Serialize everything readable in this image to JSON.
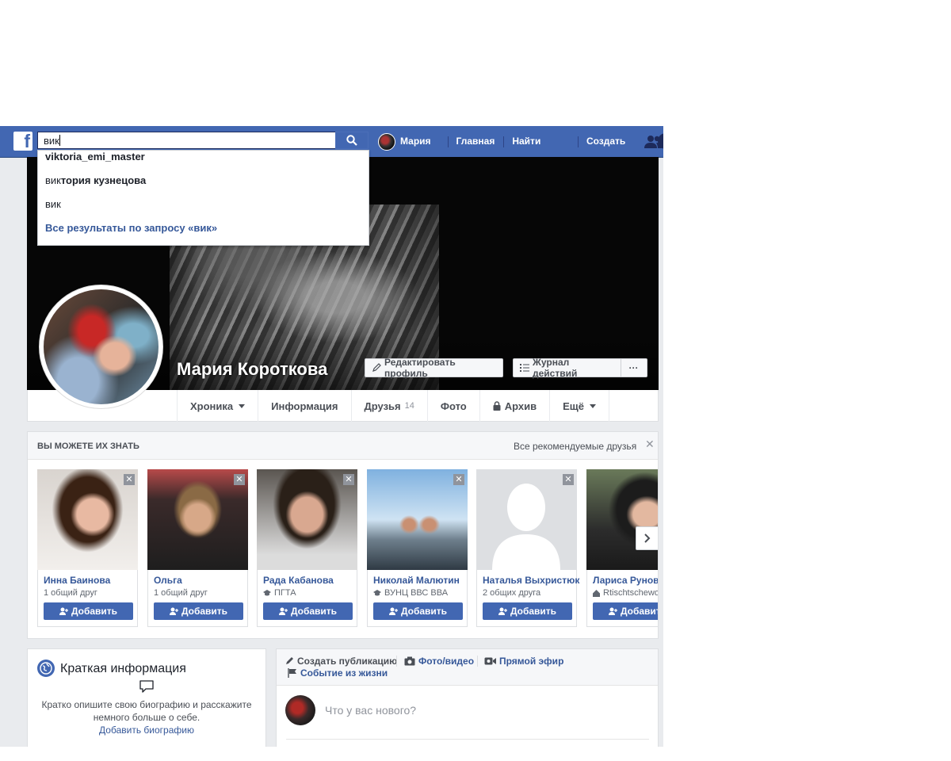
{
  "topbar": {
    "logo": "f",
    "search_value": "вик",
    "user_name": "Мария",
    "nav_links": [
      "Главная",
      "Найти друзей",
      "Создать"
    ]
  },
  "search_dropdown": {
    "item1": "viktoria_emi_master",
    "item2_prefix": "вик",
    "item2_rest": "тория кузнецова",
    "item3": "вик",
    "all_results": "Все результаты по запросу «вик»"
  },
  "profile": {
    "name": "Мария Короткова",
    "edit_profile": "Редактировать профиль",
    "activity_log": "Журнал действий",
    "more": "···"
  },
  "tabs": [
    {
      "label": "Хроника"
    },
    {
      "label": "Информация"
    },
    {
      "label": "Друзья",
      "count": "14"
    },
    {
      "label": "Фото"
    },
    {
      "label": "Архив"
    },
    {
      "label": "Ещё"
    }
  ],
  "pymk": {
    "title": "ВЫ МОЖЕТЕ ИХ ЗНАТЬ",
    "all_link": "Все рекомендуемые друзья",
    "close": "✕",
    "add_label": "Добавить",
    "people": [
      {
        "name": "Инна Баинова",
        "sub": "1 общий друг"
      },
      {
        "name": "Ольга",
        "sub": "1 общий друг"
      },
      {
        "name": "Рада Кабанова",
        "sub": "ПГТА"
      },
      {
        "name": "Николай Малютин",
        "sub": "ВУНЦ ВВС ВВА"
      },
      {
        "name": "Наталья Выхристюк",
        "sub": "2 общих друга"
      },
      {
        "name": "Лариса Рунова",
        "sub": "Rtischtschewo"
      }
    ]
  },
  "intro": {
    "title": "Краткая информация",
    "text": "Кратко опишите свою биографию и расскажите немного больше о себе.",
    "link": "Добавить биографию"
  },
  "composer": {
    "create_post": "Создать публикацию",
    "photo_video": "Фото/видео",
    "live": "Прямой эфир",
    "life_event": "Событие из жизни",
    "placeholder": "Что у вас нового?"
  }
}
